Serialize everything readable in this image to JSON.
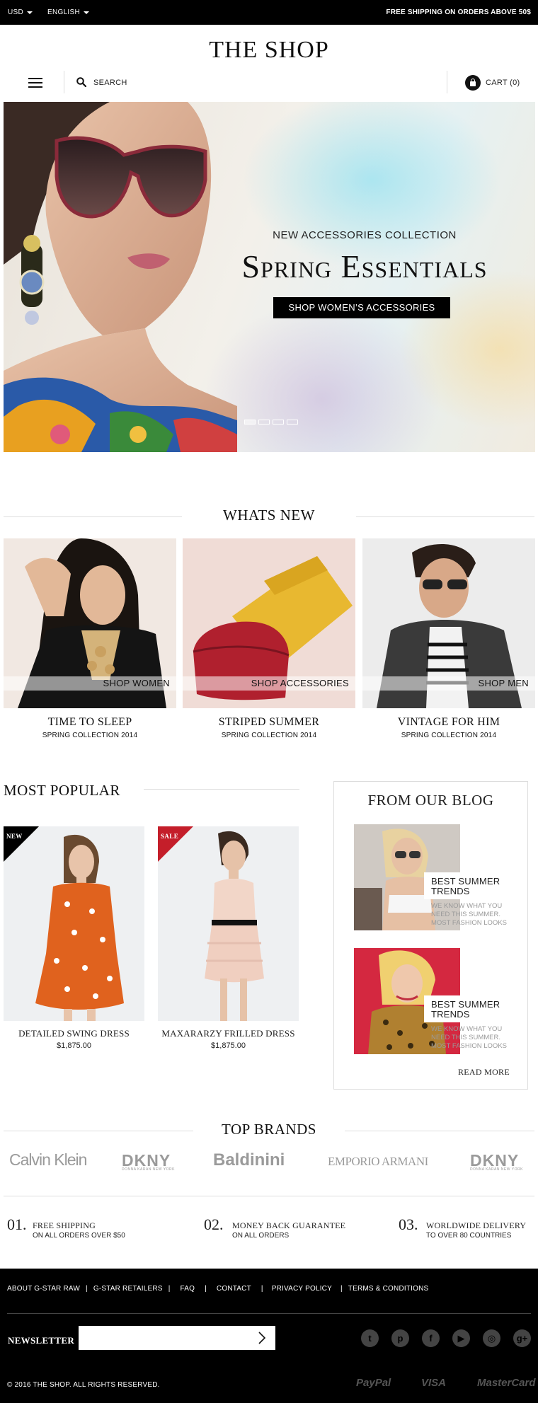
{
  "topbar": {
    "currency": "USD",
    "language": "ENGLISH",
    "shipping_notice": "FREE SHIPPING ON ORDERS ABOVE 50$"
  },
  "header": {
    "logo": "THE SHOP",
    "search_label": "SEARCH",
    "cart_label": "CART (0)"
  },
  "hero": {
    "subtitle": "NEW ACCESSORIES COLLECTION",
    "title": "Spring Essentials",
    "cta": "SHOP WOMEN’S ACCESSORIES",
    "slides": 4,
    "active_slide": 1
  },
  "whats_new": {
    "heading": "WHATS NEW",
    "items": [
      {
        "label": "SHOP WOMEN",
        "title": "TIME TO SLEEP",
        "subtitle": "SPRING COLLECTION 2014"
      },
      {
        "label": "SHOP ACCESSORIES",
        "title": "STRIPED SUMMER",
        "subtitle": "SPRING COLLECTION 2014"
      },
      {
        "label": "SHOP MEN",
        "title": "VINTAGE FOR HIM",
        "subtitle": "SPRING COLLECTION 2014"
      }
    ]
  },
  "most_popular": {
    "heading": "MOST POPULAR",
    "products": [
      {
        "badge": "NEW",
        "name": "DETAILED SWING DRESS",
        "price": "$1,875.00"
      },
      {
        "badge": "SALE",
        "name": "MAXARARZY FRILLED DRESS",
        "price": "$1,875.00"
      }
    ]
  },
  "blog": {
    "heading": "FROM OUR BLOG",
    "posts": [
      {
        "title": "BEST SUMMER TRENDS",
        "excerpt": "WE KNOW WHAT YOU NEED THIS SUMMER. MOST FASHION LOOKS"
      },
      {
        "title": "BEST SUMMER TRENDS",
        "excerpt": "WE KNOW WHAT YOU NEED THIS SUMMER. MOST FASHION LOOKS"
      }
    ],
    "read_more": "READ MORE"
  },
  "brands": {
    "heading": "TOP BRANDS",
    "items": [
      "Calvin Klein",
      "DKNY",
      "Baldinini",
      "EMPORIO ARMANI",
      "DKNY"
    ],
    "dkny_tagline": "DONNA KARAN NEW YORK"
  },
  "features": [
    {
      "num": "01.",
      "title": "FREE SHIPPING",
      "sub": "ON ALL ORDERS OVER $50"
    },
    {
      "num": "02.",
      "title": "MONEY BACK GUARANTEE",
      "sub": "ON ALL ORDERS"
    },
    {
      "num": "03.",
      "title": "WORLDWIDE DELIVERY",
      "sub": "TO OVER 80 COUNTRIES"
    }
  ],
  "footer": {
    "links": [
      "ABOUT G-STAR RAW",
      "G-STAR RETAILERS",
      "FAQ",
      "CONTACT",
      "PRIVACY POLICY",
      "TERMS & CONDITIONS"
    ],
    "separator": "|",
    "newsletter_label": "NEWSLETTER",
    "newsletter_value": "",
    "social": [
      "twitter-icon",
      "pinterest-icon",
      "facebook-icon",
      "youtube-icon",
      "instagram-icon",
      "google-plus-icon"
    ],
    "copyright": "© 2016 THE SHOP. ALL RIGHTS RESERVED.",
    "payments": [
      "PayPal",
      "VISA",
      "MasterCard"
    ]
  }
}
